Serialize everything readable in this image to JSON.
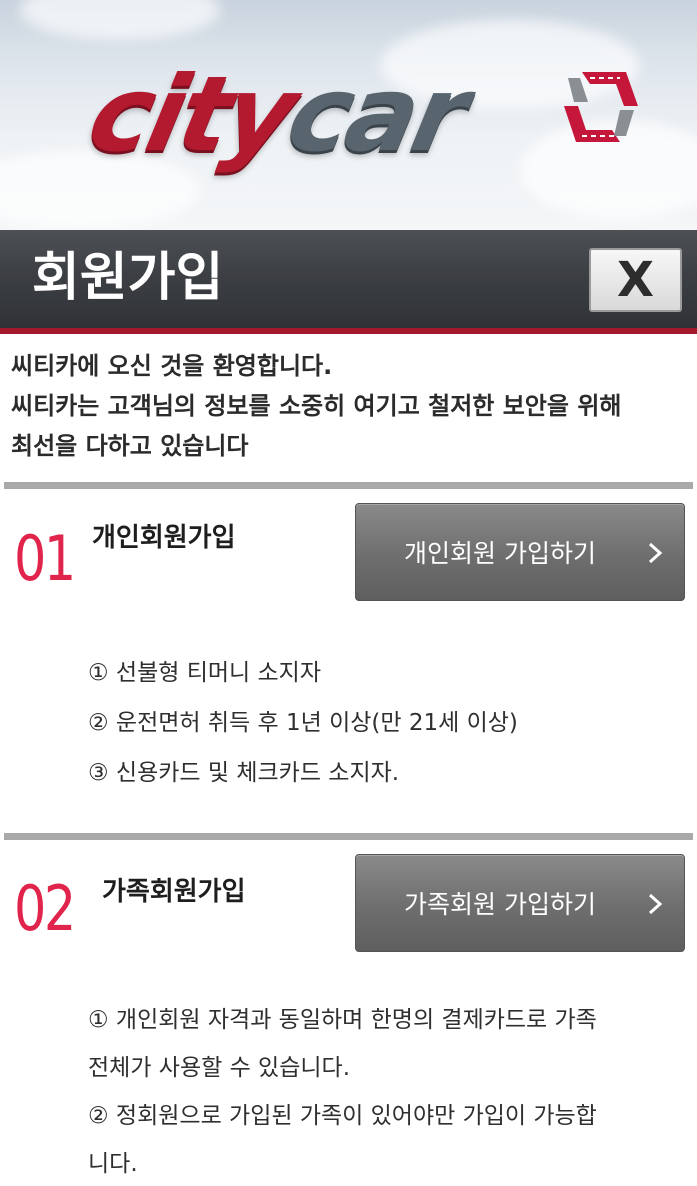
{
  "logo": {
    "part1": "city",
    "part2": "car",
    "mark_icon": "road-loop-icon"
  },
  "header": {
    "title": "회원가입",
    "close_label": "X"
  },
  "intro": {
    "lines": [
      "씨티카에 오신 것을 환영합니다.",
      "씨티카는 고객님의 정보를 소중히 여기고 철저한 보안을 위해",
      "최선을 다하고 있습니다"
    ]
  },
  "sections": [
    {
      "number": "01",
      "title": "개인회원가입",
      "button_label": "개인회원 가입하기",
      "items": [
        "① 선불형 티머니 소지자",
        "② 운전면허 취득 후 1년 이상(만 21세 이상)",
        "③ 신용카드 및 체크카드 소지자."
      ]
    },
    {
      "number": "02",
      "title": "가족회원가입",
      "button_label": "가족회원 가입하기",
      "items": [
        "① 개인회원 자격과 동일하며 한명의 결제카드로 가족",
        "전체가 사용할 수 있습니다.",
        "② 정회원으로 가입된 가족이 있어야만 가입이 가능합",
        "니다."
      ]
    }
  ],
  "colors": {
    "brand_red": "#b3192f",
    "accent_pink": "#e0244b",
    "logo_gray": "#58646e"
  }
}
